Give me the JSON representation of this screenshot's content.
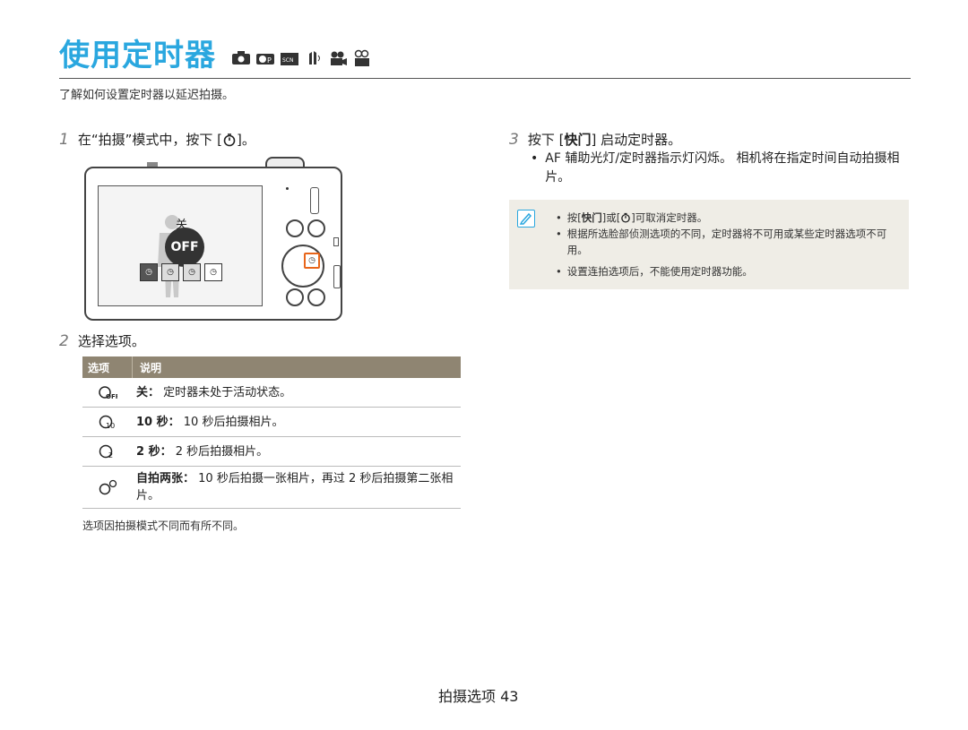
{
  "header": {
    "title": "使用定时器",
    "subtitle": "了解如何设置定时器以延迟拍摄。",
    "mode_icons": [
      "smart-auto-icon",
      "program-icon",
      "scene-icon",
      "dual-is-icon",
      "movie-icon",
      "smart-movie-icon"
    ]
  },
  "step1": {
    "num": "1",
    "text": "在“拍摄”模式中，按下 [",
    "text_end": "]。"
  },
  "camera": {
    "off_label": "关",
    "off_text": "OFF"
  },
  "step2": {
    "num": "2",
    "text": "选择选项。"
  },
  "table": {
    "col1": "选项",
    "col2": "说明",
    "rows": [
      {
        "icon": "timer-off-icon",
        "label": "关：",
        "desc": "定时器未处于活动状态。"
      },
      {
        "icon": "timer-10s-icon",
        "label": "10 秒：",
        "desc": "10 秒后拍摄相片。"
      },
      {
        "icon": "timer-2s-icon",
        "label": "2 秒：",
        "desc": "2 秒后拍摄相片。"
      },
      {
        "icon": "double-timer-icon",
        "label": "自拍两张：",
        "desc": "10 秒后拍摄一张相片，再过 2 秒后拍摄第二张相片。"
      }
    ]
  },
  "footnote": "选项因拍摄模式不同而有所不同。",
  "step3": {
    "num": "3",
    "text_a": "按下 [",
    "key": "快门",
    "text_b": "] 启动定时器。",
    "bullet": "AF 辅助光灯/定时器指示灯闪烁。 相机将在指定时间自动拍摄相片。"
  },
  "note": {
    "items": [
      {
        "a": "按[",
        "key": "快门",
        "b": "]或[",
        "c": "]可取消定时器。"
      },
      {
        "text": "根据所选脸部侦测选项的不同，定时器将不可用或某些定时器选项不可用。"
      },
      {
        "text": "设置连拍选项后，不能使用定时器功能。"
      }
    ]
  },
  "footer": {
    "section": "拍摄选项",
    "page": "43"
  },
  "colors": {
    "title": "#2aa7df",
    "table_header": "#8f8572",
    "note_bg": "#efede6",
    "accent_orange": "#e8651a"
  }
}
